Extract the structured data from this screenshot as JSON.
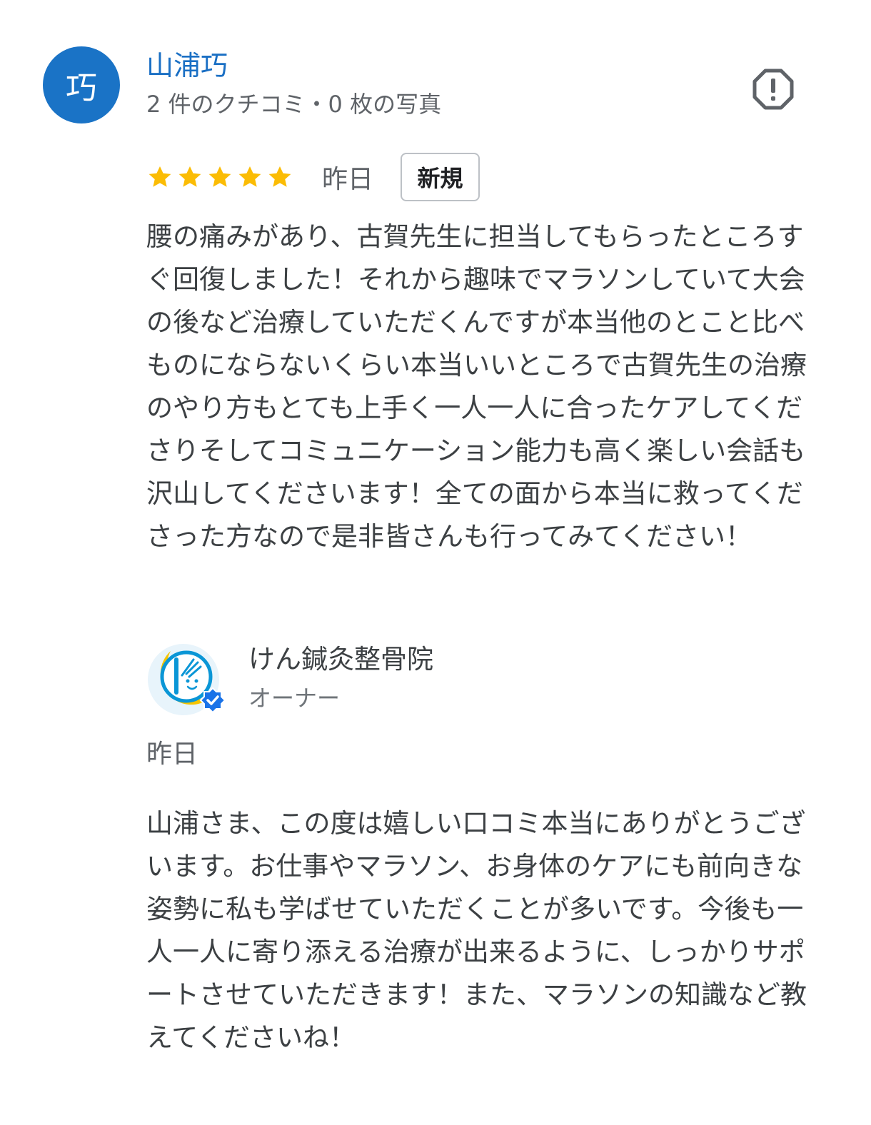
{
  "reviewer": {
    "avatar_initial": "巧",
    "name": "山浦巧",
    "meta": "2 件のクチコミ・0 枚の写真"
  },
  "review": {
    "rating": 5,
    "max_rating": 5,
    "date": "昨日",
    "badge": "新規",
    "text": "腰の痛みがあり、古賀先生に担当してもらったところすぐ回復しました！それから趣味でマラソンしていて大会の後など治療していただくんですが本当他のとこと比べものにならないくらい本当いいところで古賀先生の治療のやり方もとても上手く一人一人に合ったケアしてくださりそしてコミュニケーション能力も高く楽しい会話も沢山してくださいます！全ての面から本当に救ってくださった方なので是非皆さんも行ってみてください！"
  },
  "owner_reply": {
    "name": "けん鍼灸整骨院",
    "role": "オーナー",
    "date": "昨日",
    "text": "山浦さま、この度は嬉しい口コミ本当にありがとうございます。お仕事やマラソン、お身体のケアにも前向きな姿勢に私も学ばせていただくことが多いです。今後も一人一人に寄り添える治療が出来るように、しっかりサポートさせていただきます！また、マラソンの知識など教えてくださいね！"
  },
  "icons": {
    "report": "report-icon",
    "star": "star-icon",
    "verified": "verified-badge-icon"
  },
  "colors": {
    "avatar_bg": "#1a73c6",
    "name_link": "#1a6fc4",
    "star": "#fbbc04",
    "verified": "#1a73e8",
    "logo_yellow": "#f5c400",
    "logo_blue": "#0a96d6"
  }
}
